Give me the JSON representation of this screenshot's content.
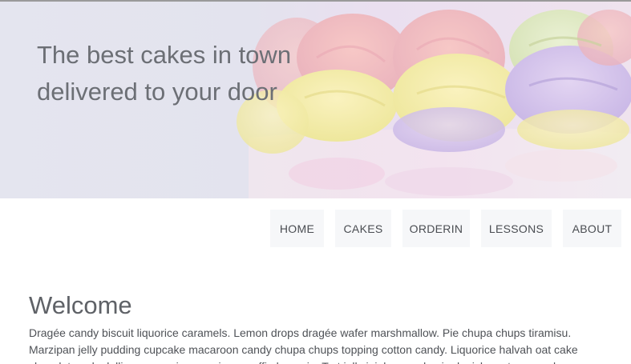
{
  "hero": {
    "line1": "The best cakes in town",
    "line2": "delivered to your door",
    "image_name": "pastel-rainbow-frosted-cake"
  },
  "nav": {
    "items": [
      {
        "label": "HOME"
      },
      {
        "label": "CAKES"
      },
      {
        "label": "ORDERIN"
      },
      {
        "label": "LESSONS"
      },
      {
        "label": "ABOUT"
      }
    ]
  },
  "main": {
    "heading": "Welcome",
    "paragraph": "Dragée candy biscuit liquorice caramels. Lemon drops dragée wafer marshmallow. Pie chupa chups tiramisu. Marzipan jelly pudding cupcake macaroon candy chupa chups topping cotton candy. Liquorice halvah oat cake chocolate cake lollipop gummies marzipan muffin brownie. Tart jelly jujubes apple pie danish pastry cupcake."
  },
  "colors": {
    "hero_bg": "#e4e5ef",
    "nav_bg": "#f6f7f9",
    "text": "#6b6e72"
  }
}
